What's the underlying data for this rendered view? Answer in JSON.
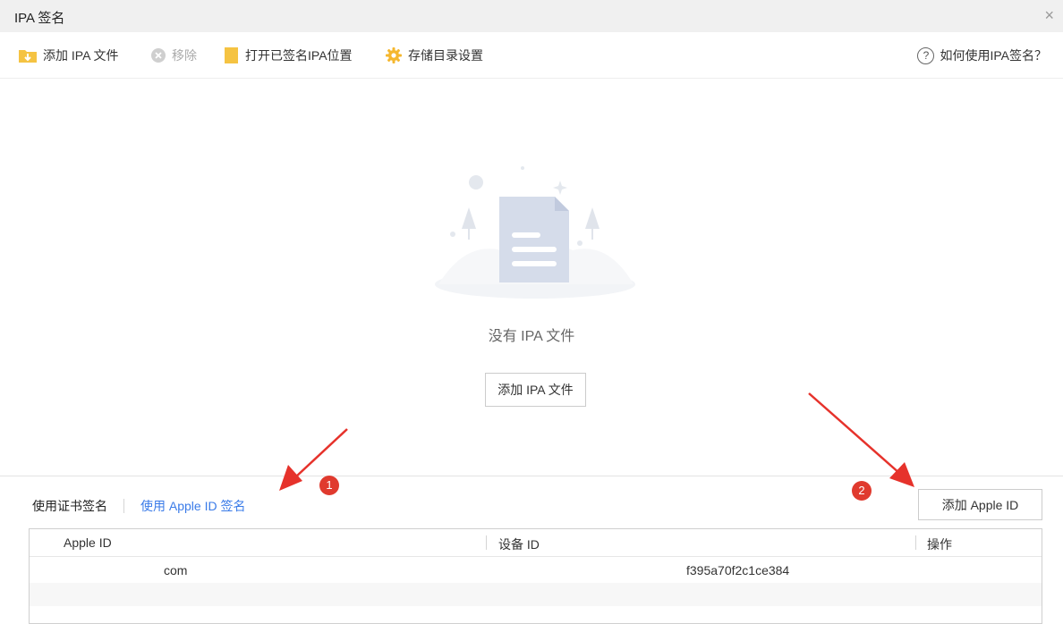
{
  "window": {
    "title": "IPA 签名",
    "close_glyph": "×"
  },
  "toolbar": {
    "add_ipa": "添加 IPA 文件",
    "remove": "移除",
    "open_location": "打开已签名IPA位置",
    "storage_settings": "存储目录设置",
    "help": "如何使用IPA签名？",
    "help_glyph": "?"
  },
  "empty": {
    "message": "没有 IPA 文件",
    "button": "添加 IPA 文件"
  },
  "signing": {
    "tabs": [
      "使用证书签名",
      "使用 Apple ID 签名"
    ],
    "add_apple_id": "添加 Apple ID"
  },
  "table": {
    "columns": [
      "Apple ID",
      "设备 ID",
      "操作"
    ],
    "rows": [
      {
        "apple_id": "com",
        "device_id": "f395a70f2c1ce384",
        "action": ""
      }
    ]
  },
  "annotations": {
    "badges": [
      "1",
      "2"
    ]
  },
  "colors": {
    "accent": "#3a7be8",
    "badge": "#e03a2e",
    "folder": "#f5c342"
  }
}
